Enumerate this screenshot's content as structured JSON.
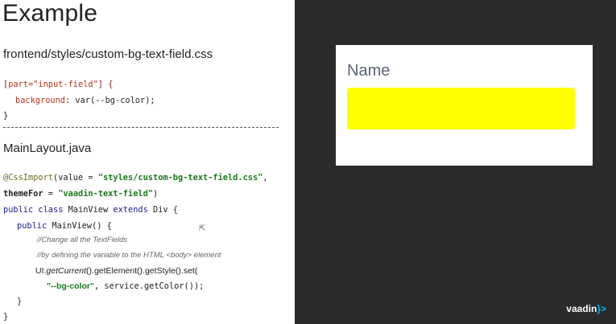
{
  "slide": {
    "title": "Example",
    "file1_name": "frontend/styles/custom-bg-text-field.css",
    "css": {
      "selector_open": "[",
      "selector_attr": "part=\"input-field\"",
      "selector_close": "] {",
      "prop_name": "background",
      "prop_value": ": var(--bg-color);",
      "close": "}"
    },
    "file2_name": "MainLayout.java",
    "java": {
      "annotation": "@CssImport",
      "anno_args_open": "(value = ",
      "anno_value": "\"styles/custom-bg-text-field.css\"",
      "anno_sep": ",",
      "themefor_key": "themeFor",
      "themefor_eq": " = ",
      "themefor_value": "\"vaadin-text-field\"",
      "themefor_close": ")",
      "class_line_kw": "public class ",
      "class_line_name": "MainView ",
      "class_line_ext": "extends ",
      "class_line_rest": "Div {",
      "ctor_kw": "public ",
      "ctor_rest": "MainView() {",
      "comment1": "//Change all the TextFields",
      "comment2": "//by defining the variable to the HTML <body> element",
      "call_ui": "UI.",
      "call_getcurrent": "getCurrent",
      "call_rest": "().getElement().getStyle().set(",
      "set_key": "\"--bg-color\"",
      "set_rest": ", service.getColor());",
      "close_inner": "}",
      "close_outer": "}"
    }
  },
  "preview": {
    "field_label": "Name",
    "field_value": "",
    "field_color": "#ffff00"
  },
  "brand": {
    "logo_text": "vaadin",
    "logo_mark": "}>"
  }
}
